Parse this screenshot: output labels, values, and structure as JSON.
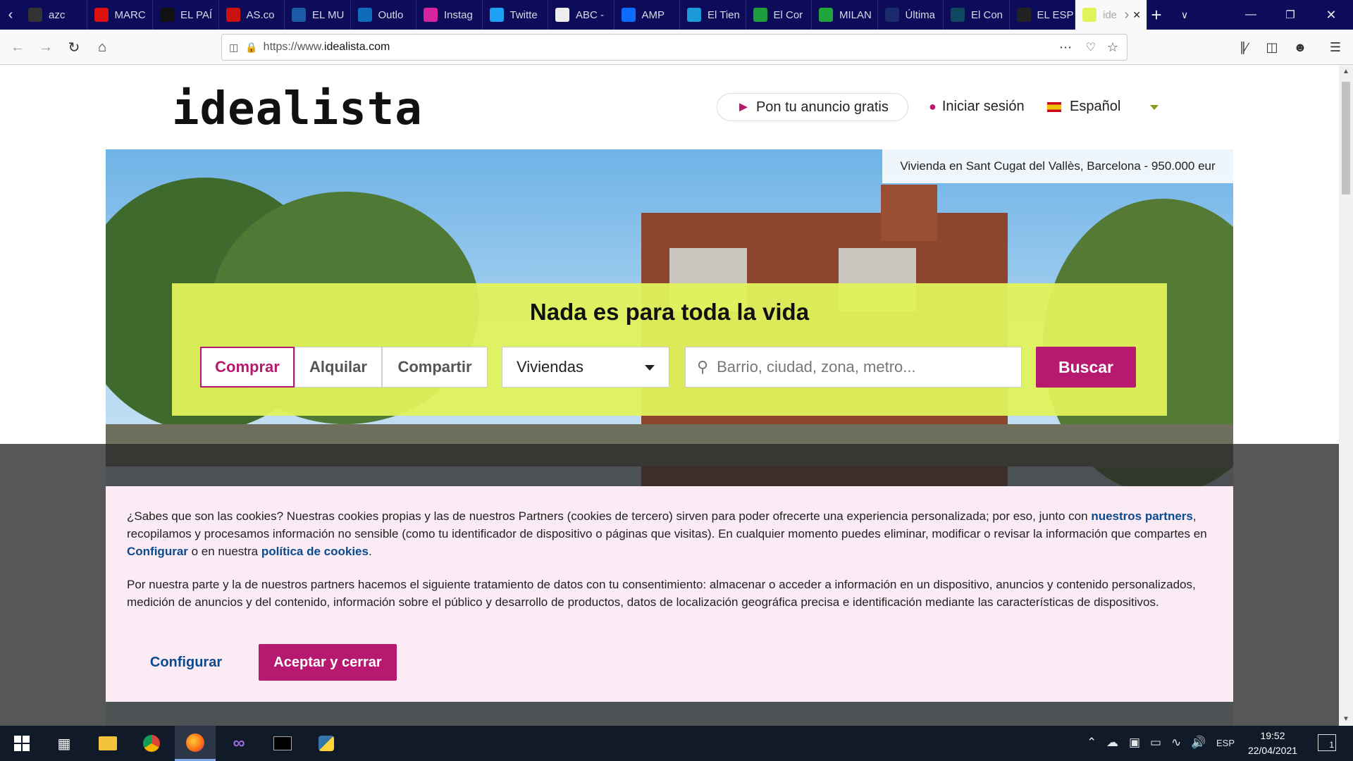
{
  "browser": {
    "tabs": [
      {
        "label": "azc",
        "favicon": "amazon-favicon",
        "color": "#333"
      },
      {
        "label": "MARC",
        "favicon": "marca-favicon",
        "color": "#d11"
      },
      {
        "label": "EL PAÍ",
        "favicon": "elpais-favicon",
        "color": "#111"
      },
      {
        "label": "AS.co",
        "favicon": "as-favicon",
        "color": "#c11"
      },
      {
        "label": "EL MU",
        "favicon": "elmundo-favicon",
        "color": "#1b5aa6"
      },
      {
        "label": "Outlo",
        "favicon": "outlook-favicon",
        "color": "#0f6cbd"
      },
      {
        "label": "Instag",
        "favicon": "instagram-favicon",
        "color": "#d6249f"
      },
      {
        "label": "Twitte",
        "favicon": "twitter-favicon",
        "color": "#1da1f2"
      },
      {
        "label": "ABC -",
        "favicon": "abc-favicon",
        "color": "#eee"
      },
      {
        "label": "AMP",
        "favicon": "amp-favicon",
        "color": "#0b6cff"
      },
      {
        "label": "El Tien",
        "favicon": "eltiempo-favicon",
        "color": "#1a9bd7"
      },
      {
        "label": "El Cor",
        "favicon": "elcorreo-favicon",
        "color": "#1c9e3c"
      },
      {
        "label": "MILAN",
        "favicon": "milanuncios-favicon",
        "color": "#1fa53a"
      },
      {
        "label": "Última",
        "favicon": "ultimahora-favicon",
        "color": "#1a2a6a"
      },
      {
        "label": "El Con",
        "favicon": "elconfidencial-favicon",
        "color": "#0d4860"
      },
      {
        "label": "EL ESP",
        "favicon": "elespanol-favicon",
        "color": "#222"
      },
      {
        "label": "ide",
        "favicon": "idealista-favicon",
        "color": "#e1f35a"
      }
    ],
    "url_prefix": "https://www.",
    "url_domain": "idealista.com"
  },
  "header": {
    "logo": "idealista",
    "publish_label": "Pon tu anuncio gratis",
    "login_label": "Iniciar sesión",
    "language_label": "Español"
  },
  "hero": {
    "caption": "Vivienda en Sant Cugat del Vallès, Barcelona - 950.000 eur",
    "title": "Nada es para toda la vida",
    "operation_tabs": [
      "Comprar",
      "Alquilar",
      "Compartir"
    ],
    "selected_tab": "Comprar",
    "property_type": "Viviendas",
    "location_placeholder": "Barrio, ciudad, zona, metro...",
    "search_label": "Buscar"
  },
  "cookie_banner": {
    "p1_a": "¿Sabes que son las cookies? Nuestras cookies propias y las de nuestros Partners (cookies de tercero) sirven para poder ofrecerte una experiencia personalizada; por eso, junto con ",
    "p1_link1": "nuestros partners",
    "p1_b": ", recopilamos y procesamos información no sensible (como tu identificador de dispositivo o páginas que visitas). En cualquier momento puedes eliminar, modificar o revisar la información que compartes en ",
    "p1_link2": "Configurar",
    "p1_c": " o en nuestra ",
    "p1_link3": "política de cookies",
    "p1_d": ".",
    "p2": "Por nuestra parte y la de nuestros partners hacemos el siguiente tratamiento de datos con tu consentimiento: almacenar o acceder a información en un dispositivo, anuncios y contenido personalizados, medición de anuncios y del contenido, información sobre el público y desarrollo de productos, datos de localización geográfica precisa e identificación mediante las características de dispositivos.",
    "configure_label": "Configurar",
    "accept_label": "Aceptar y cerrar"
  },
  "taskbar": {
    "language": "ESP",
    "time": "19:52",
    "date": "22/04/2021",
    "notifications": "1"
  },
  "colors": {
    "brand_magenta": "#b6196f",
    "brand_lime": "#e1f35a",
    "link_blue": "#0b4a8c",
    "tabbar": "#0c0c5a"
  }
}
